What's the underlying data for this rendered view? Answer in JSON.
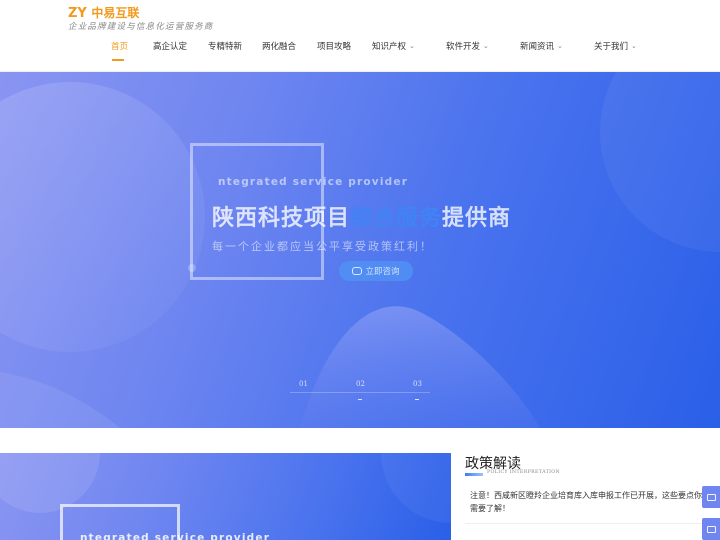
{
  "header": {
    "logo_mark": "ZY",
    "logo_name": "中易互联",
    "slogan": "企业品牌建设与信息化运营服务商"
  },
  "nav": {
    "items": [
      {
        "label": "首页",
        "active": true,
        "dropdown": false
      },
      {
        "label": "高企认定",
        "active": false,
        "dropdown": false
      },
      {
        "label": "专精特新",
        "active": false,
        "dropdown": false
      },
      {
        "label": "两化融合",
        "active": false,
        "dropdown": false
      },
      {
        "label": "项目攻略",
        "active": false,
        "dropdown": false
      },
      {
        "label": "知识产权",
        "active": false,
        "dropdown": true
      },
      {
        "label": "软件开发",
        "active": false,
        "dropdown": true
      },
      {
        "label": "新闻资讯",
        "active": false,
        "dropdown": true
      },
      {
        "label": "关于我们",
        "active": false,
        "dropdown": true
      }
    ],
    "caret_icon": "chevron-down-icon"
  },
  "hero": {
    "subtitle": "ntegrated service provider",
    "title_part1": "陕西科技项目",
    "title_highlight": "综合服务",
    "title_part2": "提供商",
    "description": "每一个企业都应当公平享受政策红利！",
    "button_label": "立即咨询",
    "button_icon": "chat-icon",
    "slides": [
      "01",
      "02",
      "03"
    ],
    "colors": {
      "gradient_start": "#8a95f2",
      "gradient_end": "#2a5fe8",
      "highlight": "#3f83f5"
    }
  },
  "lower": {
    "image_subtitle": "ntegrated service provider",
    "policy": {
      "title": "政策解读",
      "title_en": "POLICY INTERPRETATION",
      "items": [
        "注意！西咸新区瞪羚企业培育库入库申报工作已开展，这些要点你需要了解！"
      ]
    }
  },
  "accent_color": "#f39a1e"
}
